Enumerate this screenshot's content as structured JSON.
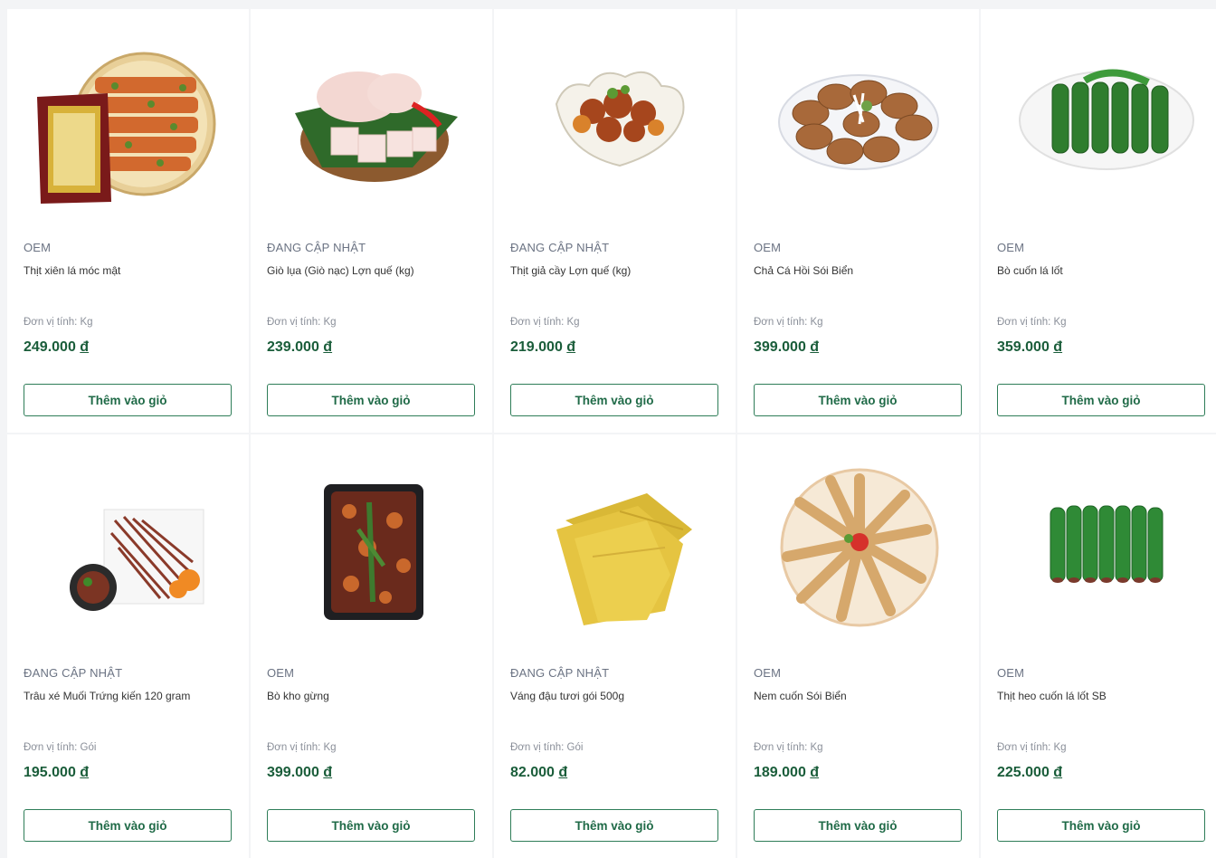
{
  "products": [
    {
      "brand": "OEM",
      "name": "Thịt xiên lá móc mật",
      "unit": "Đơn vị tính: Kg",
      "price": "249.000",
      "currency": "đ",
      "button": "Thêm vào giỏ",
      "image": "skewers-plate"
    },
    {
      "brand": "ĐANG CẬP NHẬT",
      "name": "Giò lụa (Giò nạc) Lợn quế (kg)",
      "unit": "Đơn vị tính: Kg",
      "price": "239.000",
      "currency": "đ",
      "button": "Thêm vào giỏ",
      "image": "pork-roll"
    },
    {
      "brand": "ĐANG CẬP NHẬT",
      "name": "Thịt giả cầy Lợn quế (kg)",
      "unit": "Đơn vị tính: Kg",
      "price": "219.000",
      "currency": "đ",
      "button": "Thêm vào giỏ",
      "image": "stew-bowl"
    },
    {
      "brand": "OEM",
      "name": "Chả Cá Hồi Sói Biển",
      "unit": "Đơn vị tính: Kg",
      "price": "399.000",
      "currency": "đ",
      "button": "Thêm vào giỏ",
      "image": "fish-cakes"
    },
    {
      "brand": "OEM",
      "name": "Bò cuốn lá lốt",
      "unit": "Đơn vị tính: Kg",
      "price": "359.000",
      "currency": "đ",
      "button": "Thêm vào giỏ",
      "image": "leaf-rolls-plate"
    },
    {
      "brand": "ĐANG CẬP NHẬT",
      "name": "Trâu xé Muối Trứng kiến 120 gram",
      "unit": "Đơn vị tính: Gói",
      "price": "195.000",
      "currency": "đ",
      "button": "Thêm vào giỏ",
      "image": "shredded-buffalo"
    },
    {
      "brand": "OEM",
      "name": "Bò kho gừng",
      "unit": "Đơn vị tính: Kg",
      "price": "399.000",
      "currency": "đ",
      "button": "Thêm vào giỏ",
      "image": "beef-tray"
    },
    {
      "brand": "ĐANG CẬP NHẬT",
      "name": "Váng đậu tươi gói 500g",
      "unit": "Đơn vị tính: Gói",
      "price": "82.000",
      "currency": "đ",
      "button": "Thêm vào giỏ",
      "image": "tofu-skin"
    },
    {
      "brand": "OEM",
      "name": "Nem cuốn Sói Biển",
      "unit": "Đơn vị tính: Kg",
      "price": "189.000",
      "currency": "đ",
      "button": "Thêm vào giỏ",
      "image": "spring-rolls"
    },
    {
      "brand": "OEM",
      "name": "Thịt heo cuốn lá lốt SB",
      "unit": "Đơn vị tính: Kg",
      "price": "225.000",
      "currency": "đ",
      "button": "Thêm vào giỏ",
      "image": "leaf-rolls"
    }
  ],
  "colors": {
    "price": "#1a5d3a",
    "button_border": "#2e7d58",
    "brand_text": "#6b7383"
  }
}
